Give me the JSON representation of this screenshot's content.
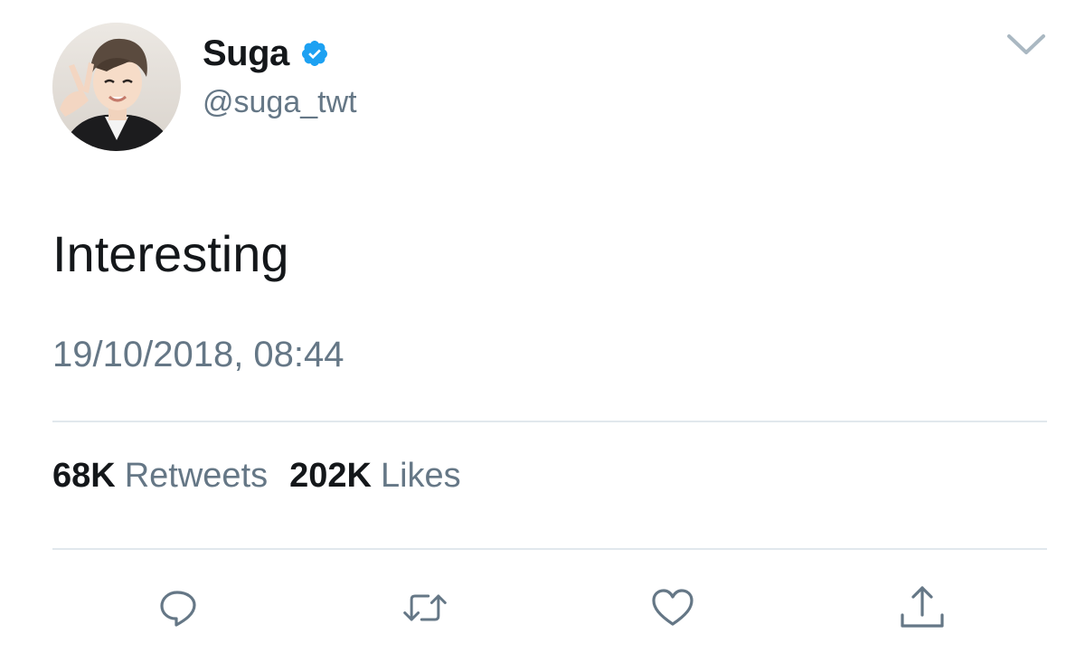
{
  "user": {
    "display_name": "Suga",
    "handle": "@suga_twt",
    "verified": true
  },
  "tweet": {
    "text": "Interesting",
    "timestamp": "19/10/2018, 08:44"
  },
  "stats": {
    "retweets_count": "68K",
    "retweets_label": "Retweets",
    "likes_count": "202K",
    "likes_label": "Likes"
  },
  "icons": {
    "verified": "verified-badge-icon",
    "more": "chevron-down-icon",
    "reply": "speech-bubble-icon",
    "retweet": "retweet-arrows-icon",
    "like": "heart-icon",
    "share": "share-upload-icon"
  },
  "colors": {
    "verified_blue": "#1da1f2",
    "text_primary": "#14171a",
    "text_secondary": "#657786",
    "divider": "#e1e8ed",
    "icon_gray": "#657786"
  }
}
